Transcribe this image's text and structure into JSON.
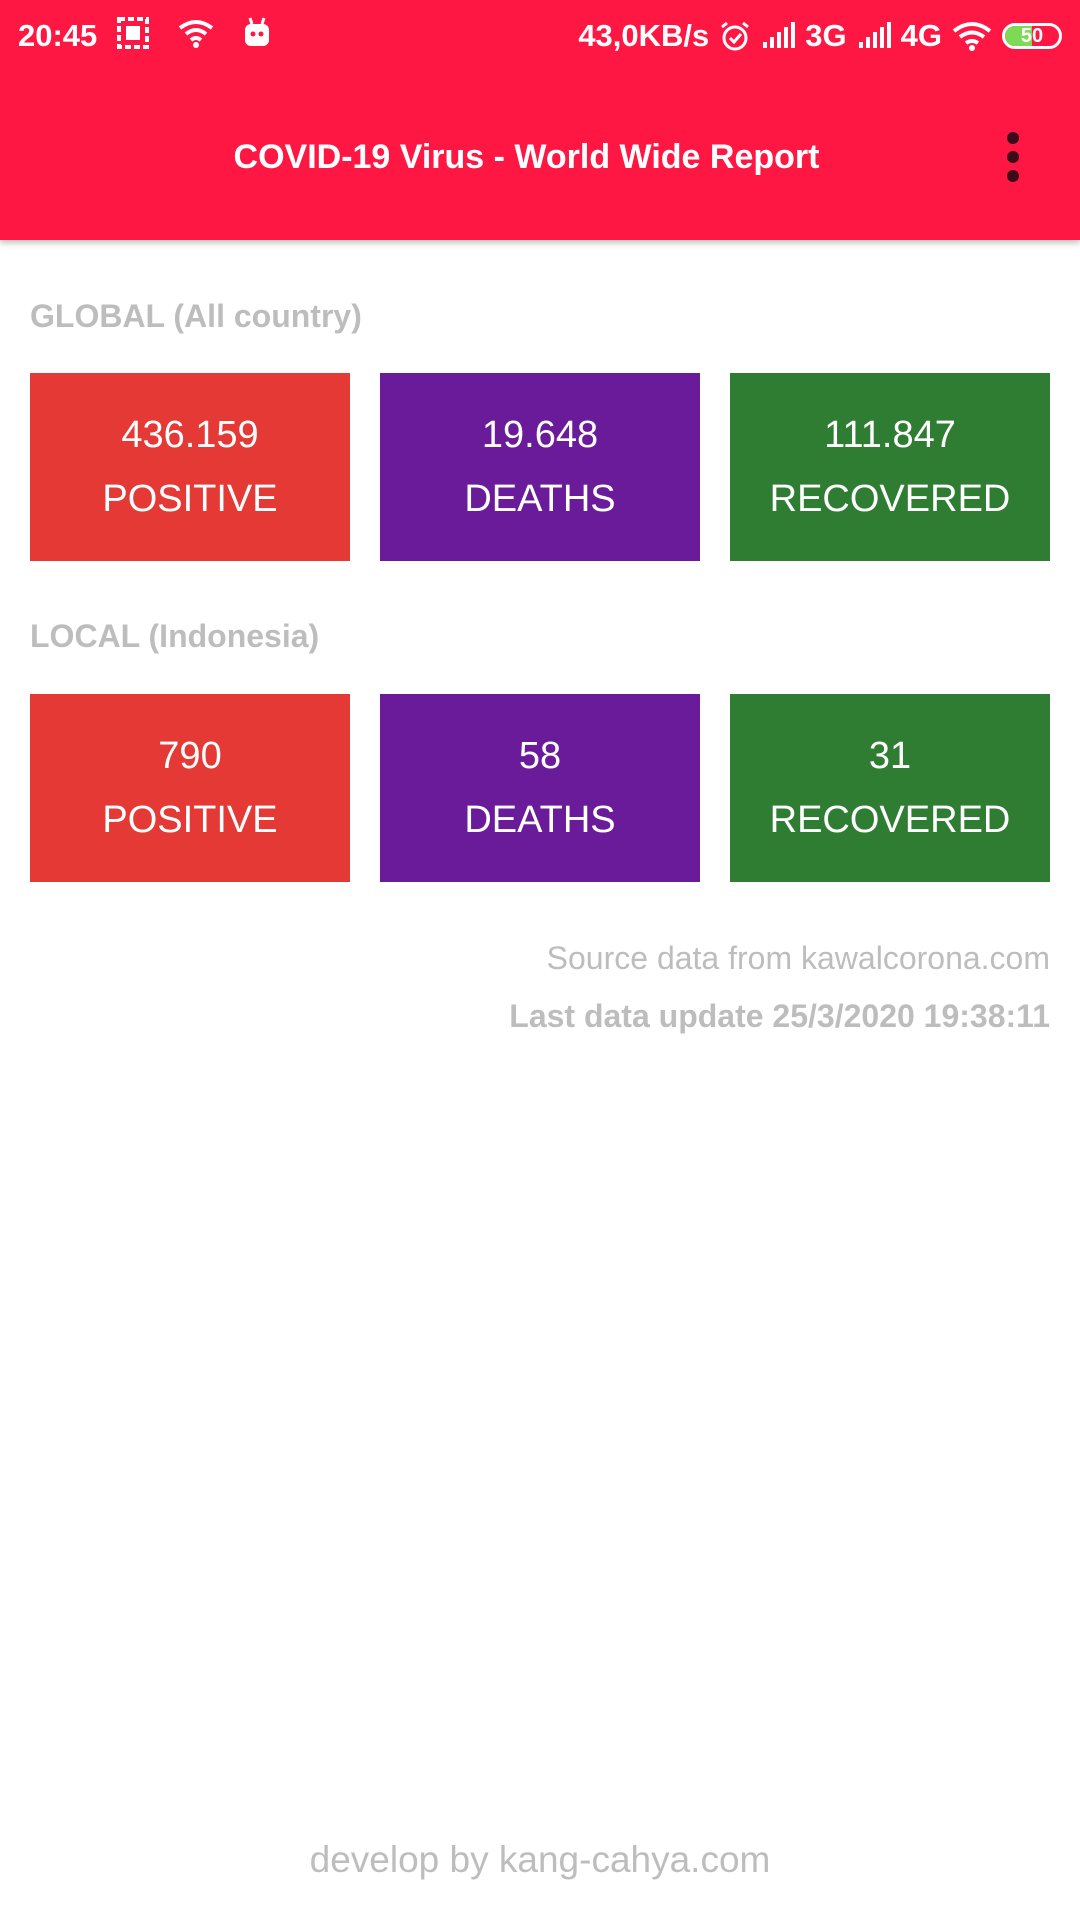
{
  "status_bar": {
    "time": "20:45",
    "net_speed": "43,0KB/s",
    "network1": "3G",
    "network2": "4G",
    "battery": "50",
    "battery_level": 0.5,
    "icons": [
      "gallery-icon",
      "wifi-icon",
      "android-icon",
      "alarm-icon",
      "signal-icon",
      "signal-icon",
      "wifi-icon",
      "battery-icon"
    ]
  },
  "app_bar": {
    "title": "COVID-19 Virus - World Wide Report",
    "menu_icon": "more-vert-icon",
    "color": "#ff1744"
  },
  "global": {
    "label": "GLOBAL (All country)",
    "positive": {
      "value": "436.159",
      "label": "POSITIVE"
    },
    "deaths": {
      "value": "19.648",
      "label": "DEATHS"
    },
    "recovered": {
      "value": "111.847",
      "label": "RECOVERED"
    }
  },
  "local": {
    "label": "LOCAL (Indonesia)",
    "positive": {
      "value": "790",
      "label": "POSITIVE"
    },
    "deaths": {
      "value": "58",
      "label": "DEATHS"
    },
    "recovered": {
      "value": "31",
      "label": "RECOVERED"
    }
  },
  "colors": {
    "positive": "#e53935",
    "deaths": "#6a1b9a",
    "recovered": "#2e7d32"
  },
  "source": "Source data from kawalcorona.com",
  "last_update": "Last data update 25/3/2020 19:38:11",
  "footer": "develop by kang-cahya.com"
}
